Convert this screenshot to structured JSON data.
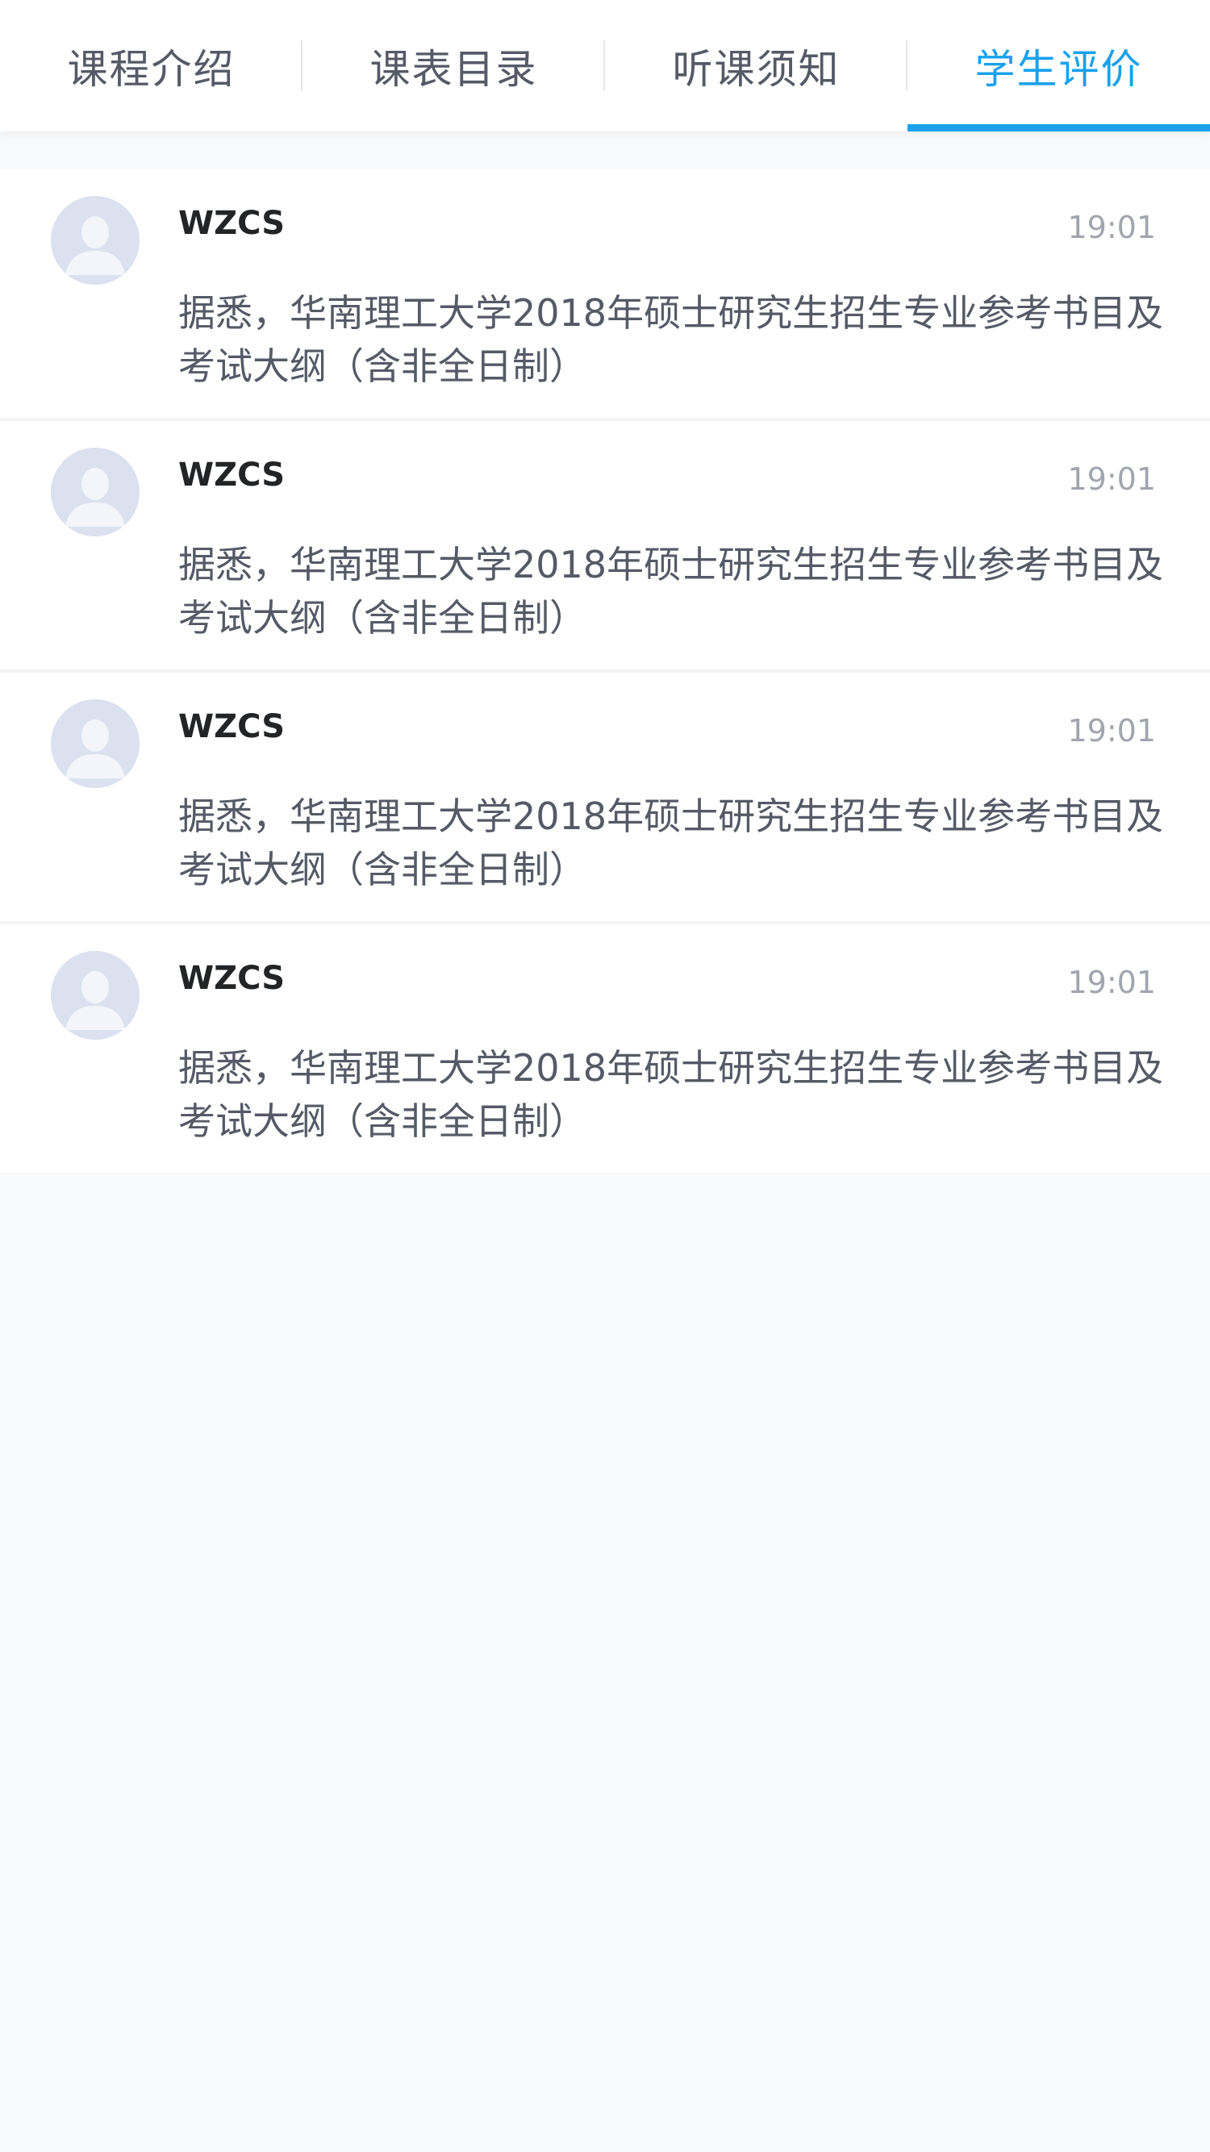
{
  "tabs": [
    {
      "label": "课程介绍",
      "active": false
    },
    {
      "label": "课表目录",
      "active": false
    },
    {
      "label": "听课须知",
      "active": false
    },
    {
      "label": "学生评价",
      "active": true
    }
  ],
  "reviews": [
    {
      "avatar": "user-avatar-icon",
      "username": "WZCS",
      "time": "19:01",
      "content": "据悉，华南理工大学2018年硕士研究生招生专业参考书目及考试大纲（含非全日制）"
    },
    {
      "avatar": "user-avatar-icon",
      "username": "WZCS",
      "time": "19:01",
      "content": "据悉，华南理工大学2018年硕士研究生招生专业参考书目及考试大纲（含非全日制）"
    },
    {
      "avatar": "user-avatar-icon",
      "username": "WZCS",
      "time": "19:01",
      "content": "据悉，华南理工大学2018年硕士研究生招生专业参考书目及考试大纲（含非全日制）"
    },
    {
      "avatar": "user-avatar-icon",
      "username": "WZCS",
      "time": "19:01",
      "content": "据悉，华南理工大学2018年硕士研究生招生专业参考书目及考试大纲（含非全日制）"
    }
  ],
  "colors": {
    "accent": "#1aa1ec",
    "text": "#555a66",
    "background": "#f8f9fb"
  }
}
